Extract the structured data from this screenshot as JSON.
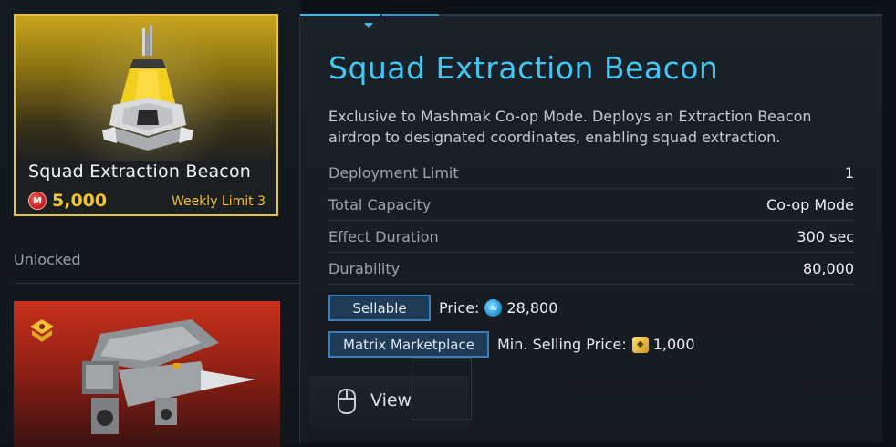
{
  "featured_item": {
    "name": "Squad Extraction Beacon",
    "price": "5,000",
    "currency_icon": "red-currency-icon",
    "limit": "Weekly Limit 3",
    "accent_color": "#e5c33a"
  },
  "section": {
    "label": "Unlocked"
  },
  "second_item": {
    "icon": "rank-chevron-icon",
    "art": "gunship-icon"
  },
  "detail": {
    "title": "Squad Extraction Beacon",
    "description": "Exclusive to Mashmak Co-op Mode. Deploys an Extraction Beacon airdrop to designated coordinates, enabling squad extraction.",
    "stats": [
      {
        "label": "Deployment Limit",
        "value": "1"
      },
      {
        "label": "Total Capacity",
        "value": "Co-op Mode"
      },
      {
        "label": "Effect Duration",
        "value": "300 sec"
      },
      {
        "label": "Durability",
        "value": "80,000"
      }
    ],
    "sellable_tag": "Sellable",
    "price_label": "Price:",
    "price_value": "28,800",
    "market_tag": "Matrix Marketplace",
    "min_price_label": "Min. Selling Price:",
    "min_price_value": "1,000",
    "view_label": "View",
    "title_color": "#43c6ef"
  }
}
